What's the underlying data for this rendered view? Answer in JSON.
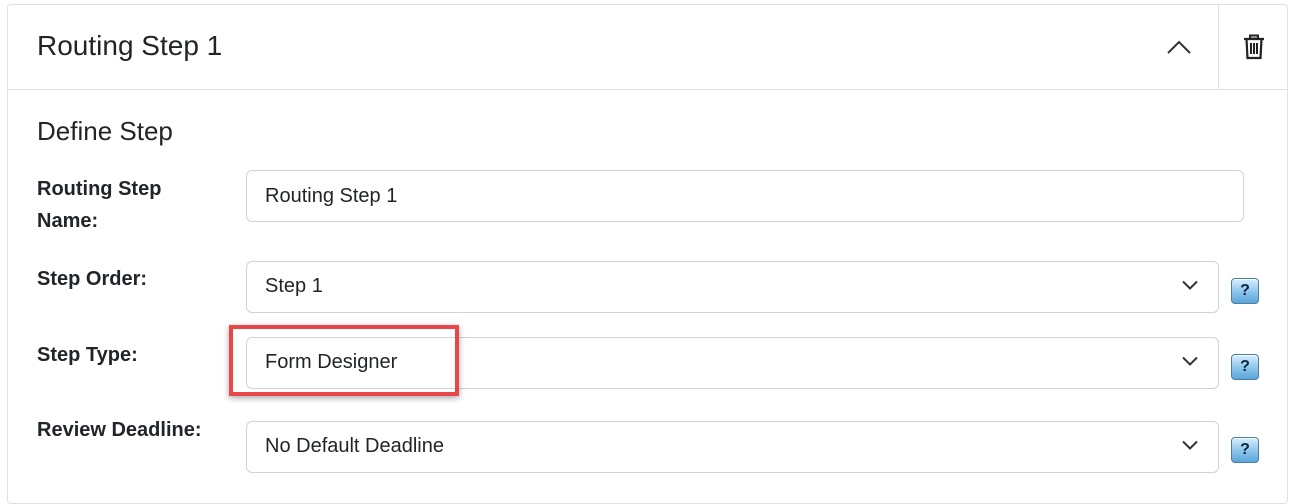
{
  "card": {
    "title": "Routing Step 1",
    "collapse_icon": "chevron-up-icon",
    "delete_icon": "trash-icon"
  },
  "section": {
    "title": "Define Step"
  },
  "fields": {
    "name": {
      "label": "Routing Step Name:",
      "value": "Routing Step 1"
    },
    "order": {
      "label": "Step Order:",
      "value": "Step 1",
      "help": "?"
    },
    "type": {
      "label": "Step Type:",
      "value": "Form Designer",
      "help": "?"
    },
    "deadline": {
      "label": "Review Deadline:",
      "value": "No Default Deadline",
      "help": "?"
    }
  },
  "colors": {
    "highlight": "#e8474a",
    "border": "#dee2e6",
    "help_button": "#8cc4ea"
  }
}
